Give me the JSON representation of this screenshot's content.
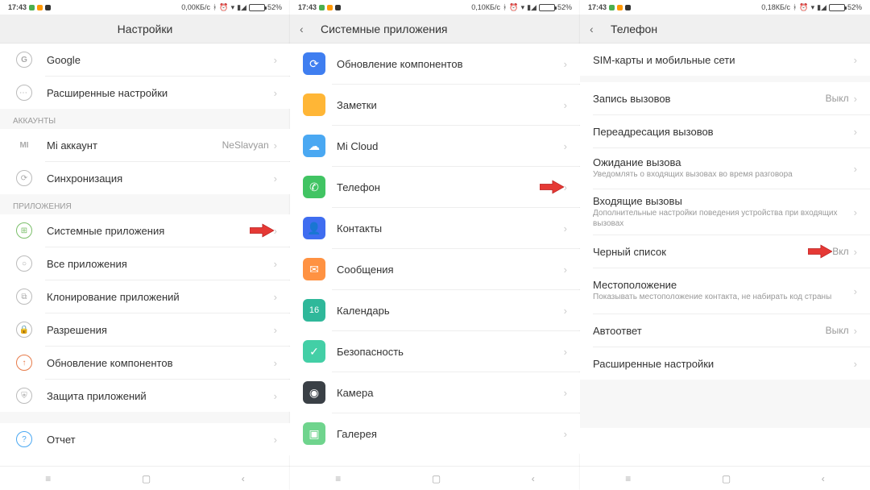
{
  "battery_pct": "52%",
  "screens": [
    {
      "time": "17:43",
      "data": "0,00КБ/с",
      "header": {
        "title": "Настройки",
        "back": false
      },
      "groups": [
        {
          "label": null,
          "items": [
            {
              "icon": "google",
              "label": "Google"
            },
            {
              "icon": "dots",
              "label": "Расширенные настройки"
            }
          ]
        },
        {
          "label": "АККАУНТЫ",
          "items": [
            {
              "icon": "mi",
              "label": "Mi аккаунт",
              "value": "NeSlavyan"
            },
            {
              "icon": "sync",
              "label": "Синхронизация"
            }
          ]
        },
        {
          "label": "ПРИЛОЖЕНИЯ",
          "items": [
            {
              "icon": "apps",
              "label": "Системные приложения",
              "arrow": true
            },
            {
              "icon": "all",
              "label": "Все приложения"
            },
            {
              "icon": "clone",
              "label": "Клонирование приложений"
            },
            {
              "icon": "perm",
              "label": "Разрешения"
            },
            {
              "icon": "update",
              "label": "Обновление компонентов"
            },
            {
              "icon": "protect",
              "label": "Защита приложений"
            }
          ]
        },
        {
          "label": null,
          "items": [
            {
              "icon": "report",
              "label": "Отчет"
            }
          ]
        }
      ]
    },
    {
      "time": "17:43",
      "data": "0,10КБ/с",
      "header": {
        "title": "Системные приложения",
        "back": true
      },
      "groups": [
        {
          "label": null,
          "items": [
            {
              "iconbg": "ic-blue",
              "glyph": "⟳",
              "label": "Обновление компонентов"
            },
            {
              "iconbg": "ic-orange",
              "glyph": "",
              "label": "Заметки"
            },
            {
              "iconbg": "ic-lightblue",
              "glyph": "☁",
              "label": "Mi Cloud"
            },
            {
              "iconbg": "ic-green",
              "glyph": "✆",
              "label": "Телефон",
              "arrow": true
            },
            {
              "iconbg": "ic-navy",
              "glyph": "👤",
              "label": "Контакты"
            },
            {
              "iconbg": "ic-orange2",
              "glyph": "✉",
              "label": "Сообщения"
            },
            {
              "iconbg": "ic-teal",
              "glyph": "16",
              "label": "Календарь"
            },
            {
              "iconbg": "ic-mint",
              "glyph": "✓",
              "label": "Безопасность"
            },
            {
              "iconbg": "ic-dark",
              "glyph": "◉",
              "label": "Камера"
            },
            {
              "iconbg": "ic-greenlt",
              "glyph": "▣",
              "label": "Галерея"
            }
          ]
        }
      ]
    },
    {
      "time": "17:43",
      "data": "0,18КБ/с",
      "header": {
        "title": "Телефон",
        "back": true
      },
      "groups": [
        {
          "label": null,
          "items": [
            {
              "label": "SIM-карты и мобильные сети"
            }
          ]
        },
        {
          "label": null,
          "items": [
            {
              "label": "Запись вызовов",
              "value": "Выкл"
            },
            {
              "label": "Переадресация вызовов"
            },
            {
              "label": "Ожидание вызова",
              "sub": "Уведомлять о входящих вызовах во время разговора"
            },
            {
              "label": "Входящие вызовы",
              "sub": "Дополнительные настройки поведения устройства при входящих вызовах"
            },
            {
              "label": "Черный список",
              "value": "Вкл",
              "arrow": true
            },
            {
              "label": "Местоположение",
              "sub": "Показывать местоположение контакта, не набирать код страны"
            },
            {
              "label": "Автоответ",
              "value": "Выкл"
            },
            {
              "label": "Расширенные настройки"
            }
          ]
        }
      ]
    }
  ]
}
